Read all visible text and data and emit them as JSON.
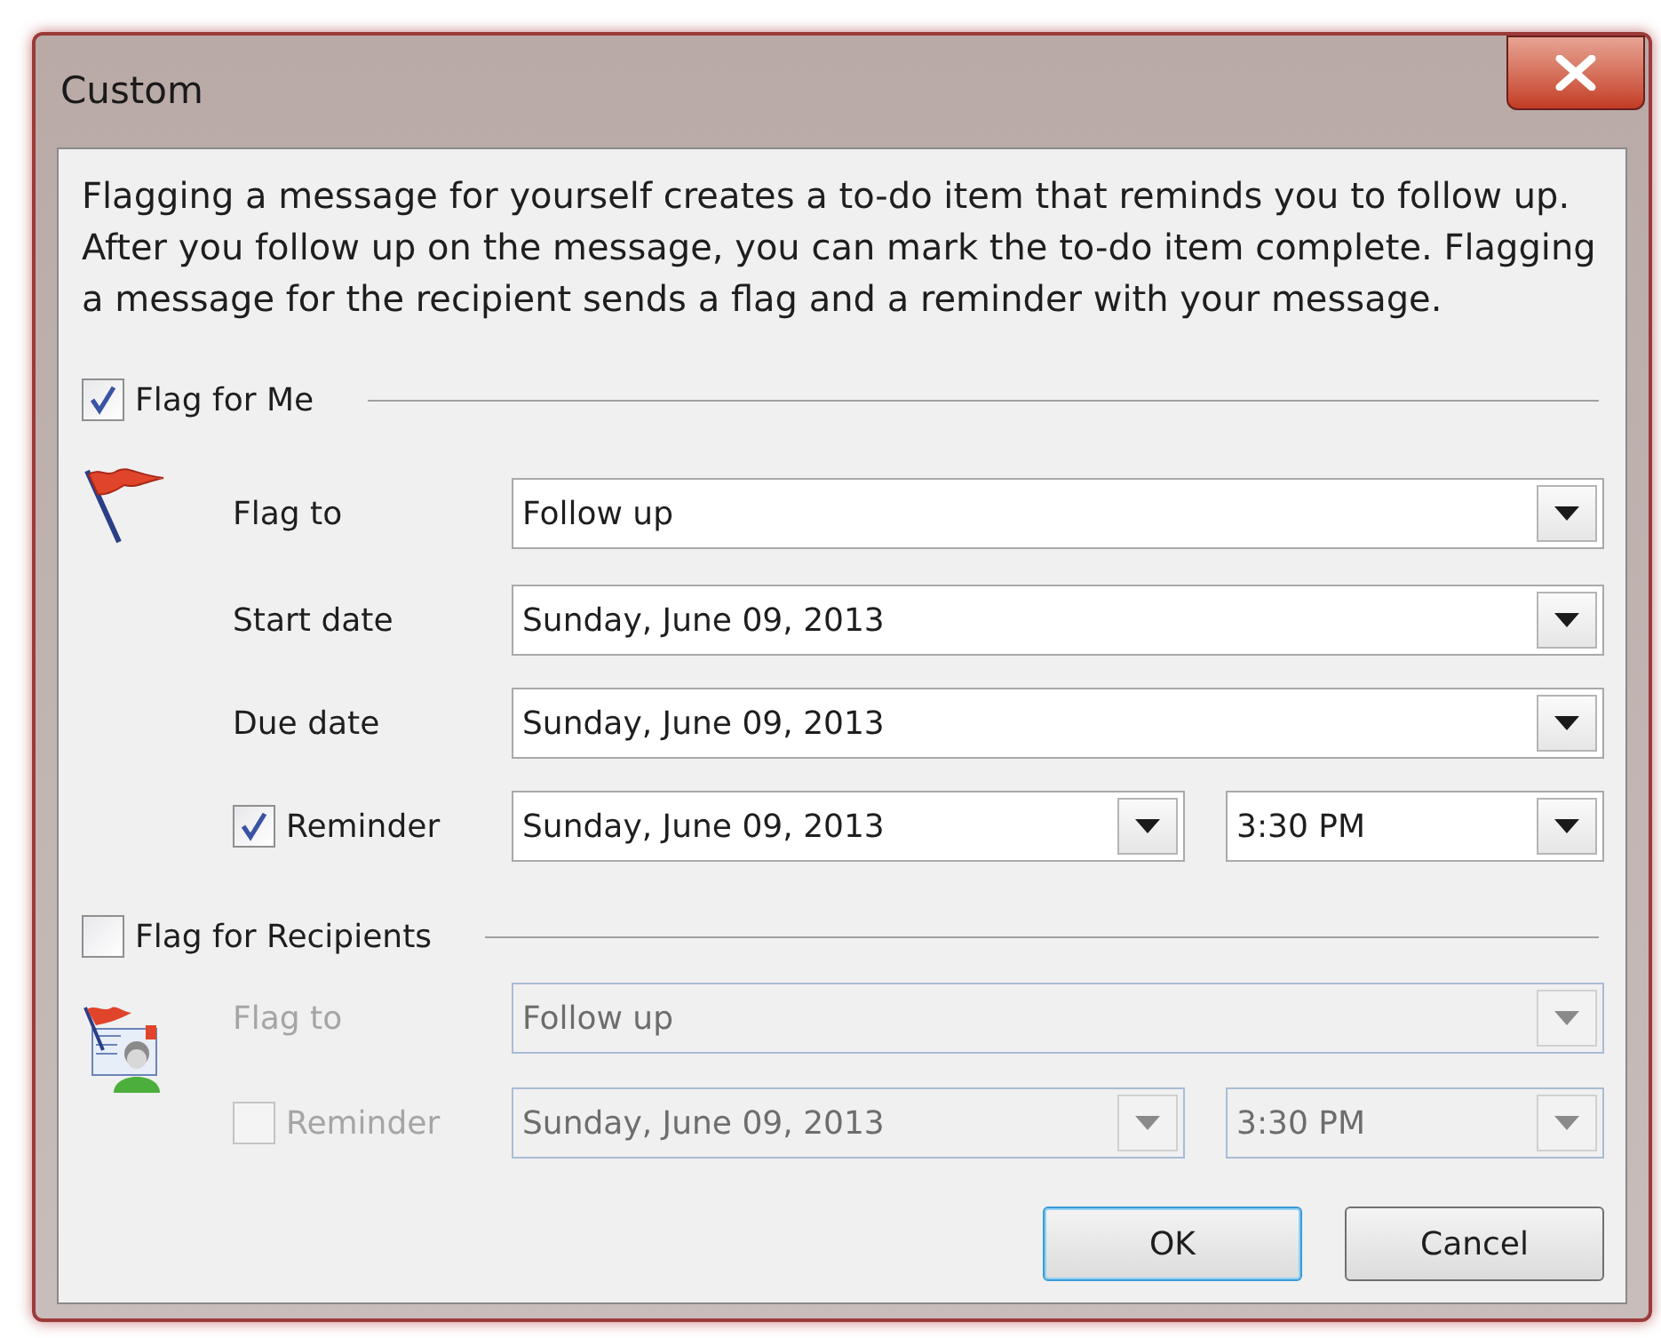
{
  "window": {
    "title": "Custom"
  },
  "description": "Flagging a message for yourself creates a to-do item that reminds you to follow up. After you follow up on the message, you can mark the to-do item complete. Flagging a message for the recipient sends a flag and a reminder with your message.",
  "sections": [
    {
      "label": "Flag for Me",
      "checked": true,
      "disabled": false,
      "rows": [
        {
          "kind": "combo",
          "label": "Flag to",
          "value": "Follow up"
        },
        {
          "kind": "combo",
          "label": "Start date",
          "value": "Sunday, June 09, 2013"
        },
        {
          "kind": "combo",
          "label": "Due date",
          "value": "Sunday, June 09, 2013"
        },
        {
          "kind": "reminder",
          "label": "Reminder",
          "checked": true,
          "date": "Sunday, June 09, 2013",
          "time": "3:30 PM"
        }
      ]
    },
    {
      "label": "Flag for Recipients",
      "checked": false,
      "disabled": true,
      "rows": [
        {
          "kind": "combo",
          "label": "Flag to",
          "value": "Follow up"
        },
        {
          "kind": "reminder",
          "label": "Reminder",
          "checked": false,
          "date": "Sunday, June 09, 2013",
          "time": "3:30 PM"
        }
      ]
    }
  ],
  "buttons": [
    {
      "label": "OK",
      "default": true
    },
    {
      "label": "Cancel",
      "default": false
    }
  ]
}
